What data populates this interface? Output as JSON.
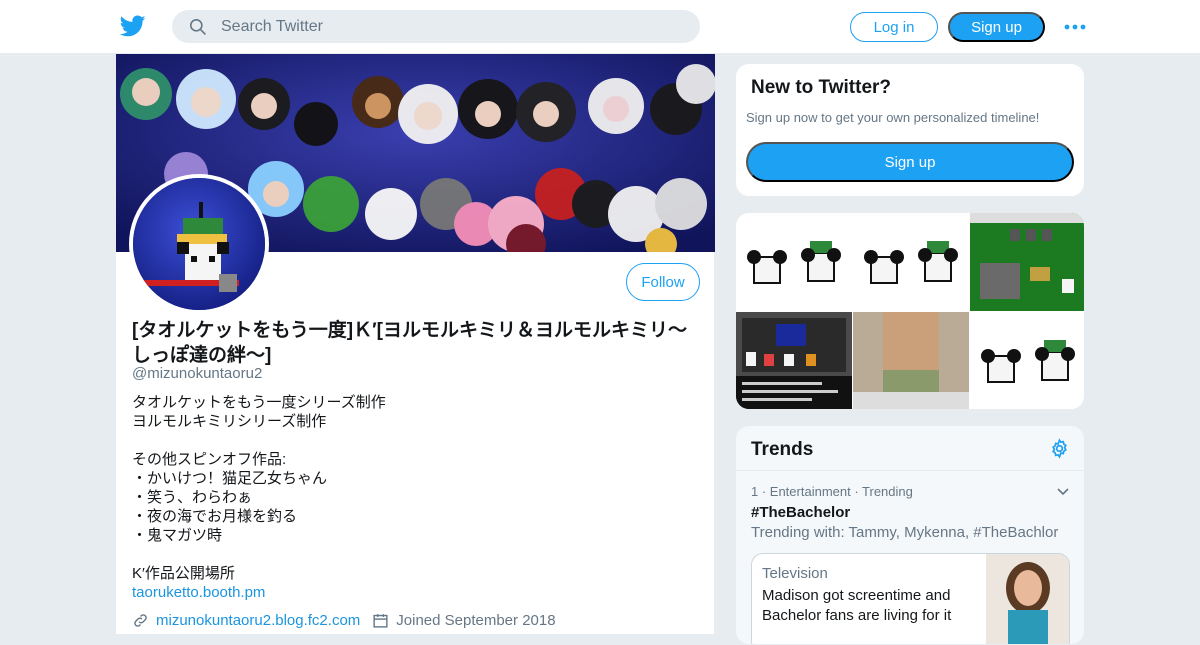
{
  "topbar": {
    "logo_icon": "twitter-bird-icon",
    "search_placeholder": "Search Twitter",
    "login_label": "Log in",
    "signup_label": "Sign up",
    "more_icon": "more-dots-icon"
  },
  "profile": {
    "follow_label": "Follow",
    "name": "[タオルケットをもう一度]Ｋ′[ヨルモルキミリ＆ヨルモルキミリ～しっぽ達の絆～]",
    "handle": "@mizunokuntaoru2",
    "bio_lines": [
      "タオルケットをもう一度シリーズ制作",
      "ヨルモルキミリシリーズ制作",
      "",
      "その他スピンオフ作品:",
      "・かいけつ！猫足乙女ちゃん",
      "・笑う、わらわぁ",
      "・夜の海でお月様を釣る",
      "・鬼マガツ時",
      "",
      "K′作品公開場所"
    ],
    "bio_link": "taoruketto.booth.pm",
    "website": "mizunokuntaoru2.blog.fc2.com",
    "joined": "Joined September 2018"
  },
  "new_to_twitter": {
    "title": "New to Twitter?",
    "subtitle": "Sign up now to get your own personalized timeline!",
    "button": "Sign up"
  },
  "trends": {
    "title": "Trends",
    "items": [
      {
        "rank": "1",
        "meta": "1 · Entertainment · Trending",
        "name": "#TheBachelor",
        "with": "Trending with: Tammy, Mykenna, #TheBachlor",
        "story_category": "Television",
        "story_headline": "Madison got screentime and Bachelor fans are living for it"
      }
    ]
  },
  "colors": {
    "accent": "#1da1f2",
    "link": "#1b95e0",
    "muted": "#657786",
    "background": "#e6ecf0"
  }
}
